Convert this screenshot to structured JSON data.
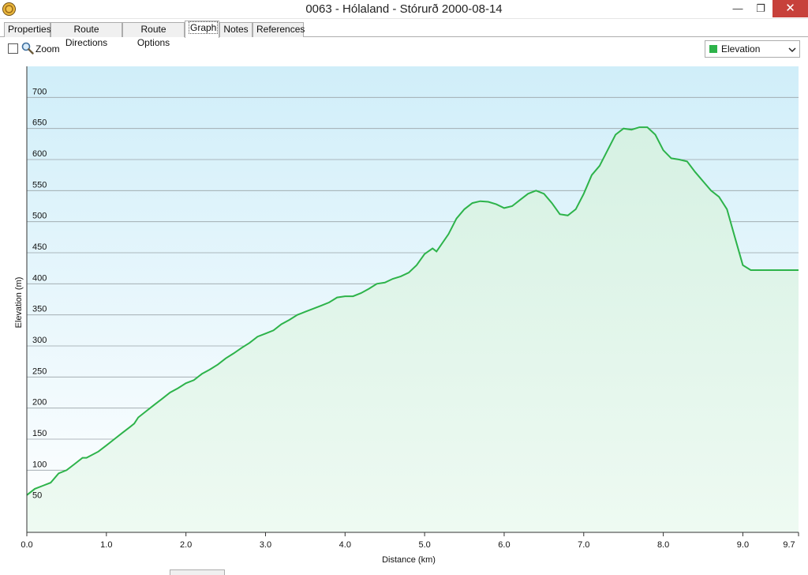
{
  "window": {
    "title": "0063 - Hólaland - Stórurð 2000-08-14",
    "min_glyph": "—",
    "max_glyph": "❐",
    "close_glyph": "✕"
  },
  "tabs": [
    {
      "label": "Properties",
      "active": false
    },
    {
      "label": "Route Directions",
      "active": false
    },
    {
      "label": "Route Options",
      "active": false
    },
    {
      "label": "Graph",
      "active": true
    },
    {
      "label": "Notes",
      "active": false
    },
    {
      "label": "References",
      "active": false
    }
  ],
  "toolbar": {
    "zoom_label": "Zoom",
    "zoom_checked": false,
    "series_selected": "Elevation",
    "series_color": "#2db34a"
  },
  "icons": {
    "app": "app-globe-icon",
    "zoom": "magnifier-icon",
    "dropdown": "chevron-down-icon"
  },
  "chart_data": {
    "type": "area",
    "xlabel": "Distance  (km)",
    "ylabel": "Elevation (m)",
    "xlim": [
      0,
      9.7
    ],
    "ylim": [
      0,
      750
    ],
    "x_ticks": [
      {
        "v": 0,
        "label": "0.0"
      },
      {
        "v": 1,
        "label": "1.0"
      },
      {
        "v": 2,
        "label": "2.0"
      },
      {
        "v": 3,
        "label": "3.0"
      },
      {
        "v": 4,
        "label": "4.0"
      },
      {
        "v": 5,
        "label": "5.0"
      },
      {
        "v": 6,
        "label": "6.0"
      },
      {
        "v": 7,
        "label": "7.0"
      },
      {
        "v": 8,
        "label": "8.0"
      },
      {
        "v": 9,
        "label": "9.0"
      },
      {
        "v": 9.7,
        "label": "9.7"
      }
    ],
    "y_ticks": [
      50,
      100,
      150,
      200,
      250,
      300,
      350,
      400,
      450,
      500,
      550,
      600,
      650,
      700
    ],
    "grid": true,
    "line_color": "#2db34a",
    "series": [
      {
        "x": [
          0,
          0.1,
          0.2,
          0.3,
          0.4,
          0.5,
          0.6,
          0.7,
          0.75,
          0.9,
          1.0,
          1.1,
          1.2,
          1.3,
          1.35,
          1.4,
          1.5,
          1.6,
          1.7,
          1.8,
          1.9,
          2.0,
          2.1,
          2.2,
          2.3,
          2.4,
          2.5,
          2.6,
          2.7,
          2.8,
          2.9,
          3.0,
          3.1,
          3.2,
          3.3,
          3.4,
          3.5,
          3.6,
          3.7,
          3.8,
          3.9,
          4.0,
          4.1,
          4.2,
          4.3,
          4.4,
          4.5,
          4.6,
          4.7,
          4.8,
          4.9,
          5.0,
          5.1,
          5.15,
          5.3,
          5.4,
          5.5,
          5.6,
          5.7,
          5.8,
          5.9,
          6.0,
          6.1,
          6.2,
          6.3,
          6.4,
          6.5,
          6.6,
          6.7,
          6.8,
          6.9,
          7.0,
          7.1,
          7.2,
          7.3,
          7.4,
          7.5,
          7.6,
          7.7,
          7.8,
          7.9,
          8.0,
          8.1,
          8.2,
          8.3,
          8.4,
          8.5,
          8.6,
          8.7,
          8.8,
          8.9,
          9.0,
          9.1,
          9.2,
          9.3,
          9.4,
          9.5,
          9.6,
          9.7
        ],
        "y": [
          60,
          70,
          75,
          80,
          95,
          100,
          110,
          120,
          120,
          130,
          140,
          150,
          160,
          170,
          175,
          185,
          195,
          205,
          215,
          225,
          232,
          240,
          245,
          255,
          262,
          270,
          280,
          288,
          297,
          305,
          315,
          320,
          325,
          335,
          342,
          350,
          355,
          360,
          365,
          370,
          378,
          380,
          380,
          385,
          392,
          400,
          402,
          408,
          412,
          418,
          430,
          448,
          457,
          452,
          480,
          505,
          520,
          530,
          533,
          532,
          528,
          522,
          525,
          535,
          545,
          550,
          545,
          530,
          512,
          510,
          520,
          545,
          575,
          590,
          615,
          640,
          650,
          648,
          652,
          652,
          640,
          615,
          602,
          600,
          597,
          580,
          565,
          550,
          540,
          520,
          475,
          430,
          422,
          422,
          422,
          422,
          422,
          422,
          422
        ]
      }
    ]
  }
}
